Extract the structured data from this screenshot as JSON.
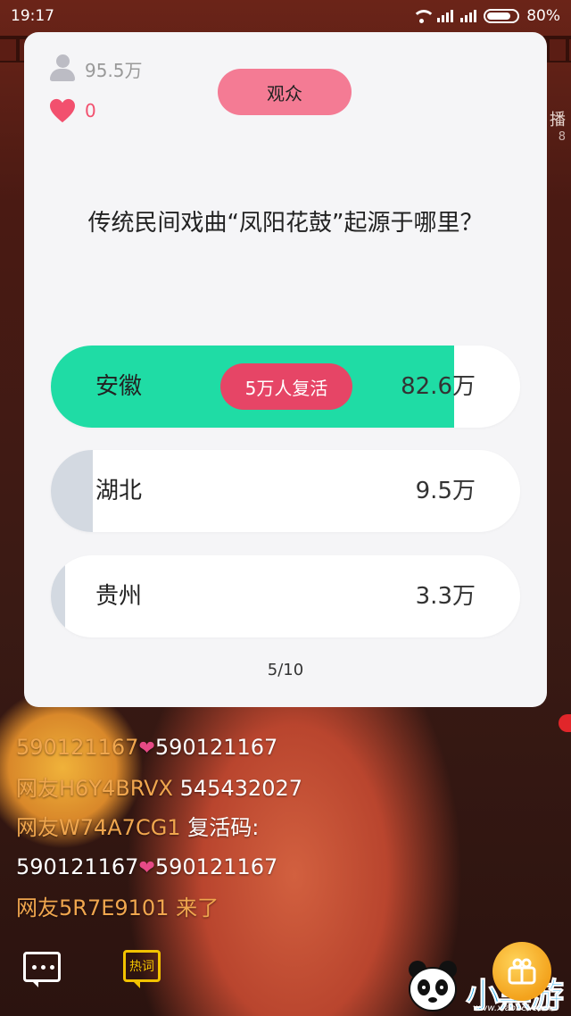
{
  "status_bar": {
    "time": "19:17",
    "battery": "80%"
  },
  "stage": {
    "side_text": "播",
    "side_num": "8"
  },
  "card": {
    "viewers": "95.5万",
    "likes": "0",
    "role": "观众",
    "question": "传统民间戏曲“凤阳花鼓”起源于哪里？",
    "options": [
      {
        "label": "安徽",
        "count": "82.6万",
        "share": 0.86,
        "correct": true,
        "bar_color": "#1fdca5"
      },
      {
        "label": "湖北",
        "count": "9.5万",
        "share": 0.09,
        "correct": false,
        "bar_color": "#d3d9e1"
      },
      {
        "label": "贵州",
        "count": "3.3万",
        "share": 0.03,
        "correct": false,
        "bar_color": "#d3d9e1"
      }
    ],
    "revive_badge": "5万人复活",
    "progress": "5/10"
  },
  "chat": [
    {
      "user": "590121167",
      "heart": "❤",
      "text": "590121167"
    },
    {
      "user": "网友H6Y4BRVX",
      "text": "545432027"
    },
    {
      "user": "网友W74A7CG1",
      "text": "复活码:",
      "text2": "590121167",
      "heart2": "❤",
      "text3": "590121167"
    },
    {
      "user": "网友5R7E9101",
      "text": "来了"
    }
  ],
  "bottom": {
    "hot_label": "热词"
  },
  "watermark": {
    "text": "小黑游戏",
    "url": "www.xiaohei.com"
  },
  "colors": {
    "accent_pink": "#f47b94",
    "correct_green": "#1fdca5",
    "badge_red": "#e64566",
    "chat_user": "#f0a64e"
  }
}
